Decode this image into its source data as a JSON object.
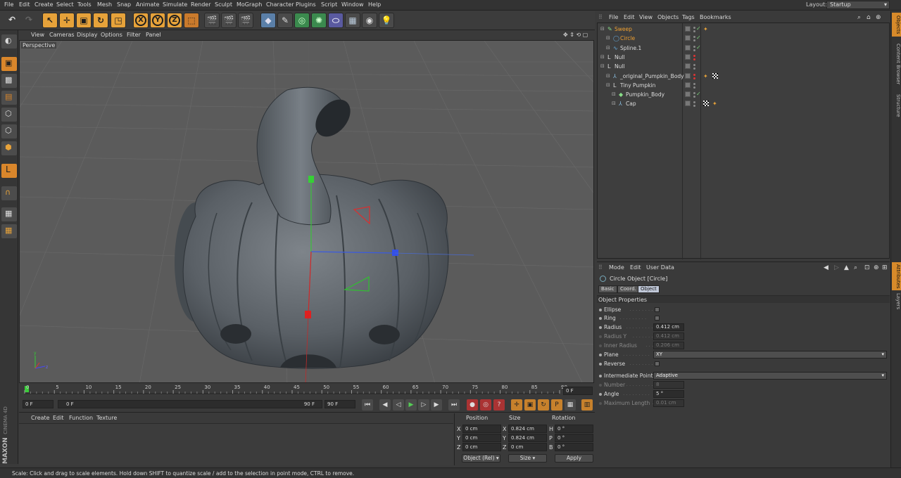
{
  "menubar": {
    "items": [
      "File",
      "Edit",
      "Create",
      "Select",
      "Tools",
      "Mesh",
      "Snap",
      "Animate",
      "Simulate",
      "Render",
      "Sculpt",
      "MoGraph",
      "Character",
      "Plugins",
      "Script",
      "Window",
      "Help"
    ],
    "layout_label": "Layout:",
    "layout_value": "Startup"
  },
  "viewport": {
    "menu": [
      "View",
      "Cameras",
      "Display",
      "Options",
      "Filter",
      "Panel"
    ],
    "camera_label": "Perspective"
  },
  "timeline": {
    "ticks": [
      "0",
      "5",
      "10",
      "15",
      "20",
      "25",
      "30",
      "35",
      "40",
      "45",
      "50",
      "55",
      "60",
      "65",
      "70",
      "75",
      "80",
      "85",
      "90"
    ],
    "end_frame_field": "0 F",
    "current_frame": "0 F",
    "range_start": "0 F",
    "range_end": "90 F",
    "max_frame": "90 F"
  },
  "material_panel": {
    "menu": [
      "Create",
      "Edit",
      "Function",
      "Texture"
    ]
  },
  "coord_manager": {
    "headers": [
      "Position",
      "Size",
      "Rotation"
    ],
    "rows": [
      {
        "axis": "X",
        "pos": "0 cm",
        "size_axis": "X",
        "size": "0.824 cm",
        "rot_axis": "H",
        "rot": "0 °"
      },
      {
        "axis": "Y",
        "pos": "0 cm",
        "size_axis": "Y",
        "size": "0.824 cm",
        "rot_axis": "P",
        "rot": "0 °"
      },
      {
        "axis": "Z",
        "pos": "0 cm",
        "size_axis": "Z",
        "size": "0 cm",
        "rot_axis": "B",
        "rot": "0 °"
      }
    ],
    "mode_select": "Object (Rel)",
    "size_select": "Size",
    "apply_label": "Apply"
  },
  "maxon_logo": {
    "line1": "MAXON",
    "line2": "CINEMA 4D"
  },
  "status_text": "Scale: Click and drag to scale elements. Hold down SHIFT to quantize scale / add to the selection in point mode, CTRL to remove.",
  "object_manager": {
    "menu": [
      "File",
      "Edit",
      "View",
      "Objects",
      "Tags",
      "Bookmarks"
    ],
    "objects": [
      {
        "name": "Sweep",
        "indent": 0,
        "selected": true
      },
      {
        "name": "Circle",
        "indent": 1,
        "selected": true
      },
      {
        "name": "Spline.1",
        "indent": 1,
        "selected": false
      },
      {
        "name": "Null",
        "indent": 0,
        "selected": false
      },
      {
        "name": "Null",
        "indent": 0,
        "selected": false
      },
      {
        "name": "_original_Pumpkin_Body",
        "indent": 1,
        "selected": false
      },
      {
        "name": "Tiny Pumpkin",
        "indent": 1,
        "selected": false
      },
      {
        "name": "Pumpkin_Body",
        "indent": 2,
        "selected": false
      },
      {
        "name": "Cap",
        "indent": 2,
        "selected": false
      }
    ]
  },
  "side_tabs": [
    "Objects",
    "Content Browser",
    "Structure"
  ],
  "side_tabs_lower": [
    "Attributes",
    "Layers"
  ],
  "attribute_manager": {
    "menu": [
      "Mode",
      "Edit",
      "User Data"
    ],
    "object_title": "Circle Object [Circle]",
    "tabs": [
      "Basic",
      "Coord.",
      "Object"
    ],
    "section": "Object Properties",
    "props": [
      {
        "label": "Ellipse",
        "type": "check",
        "dim": false
      },
      {
        "label": "Ring",
        "type": "check",
        "dim": false
      },
      {
        "label": "Radius",
        "type": "value",
        "value": "0.412 cm",
        "dim": false
      },
      {
        "label": "Radius Y",
        "type": "value",
        "value": "0.412 cm",
        "dim": true
      },
      {
        "label": "Inner Radius",
        "type": "value",
        "value": "0.206 cm",
        "dim": true
      },
      {
        "label": "Plane",
        "type": "dropdown",
        "value": "XY",
        "dim": false
      },
      {
        "label": "Reverse",
        "type": "check",
        "dim": false
      },
      {
        "label": "Intermediate Points",
        "type": "dropdown",
        "value": "Adaptive",
        "dim": false
      },
      {
        "label": "Number",
        "type": "value",
        "value": "8",
        "dim": true
      },
      {
        "label": "Angle",
        "type": "value",
        "value": "5 °",
        "dim": false
      },
      {
        "label": "Maximum Length",
        "type": "value",
        "value": "0.01 cm",
        "dim": true
      }
    ]
  },
  "colors": {
    "accent": "#e6a23a",
    "selected_text": "#f0a030",
    "viewport_bg": "#5b5b5b"
  }
}
